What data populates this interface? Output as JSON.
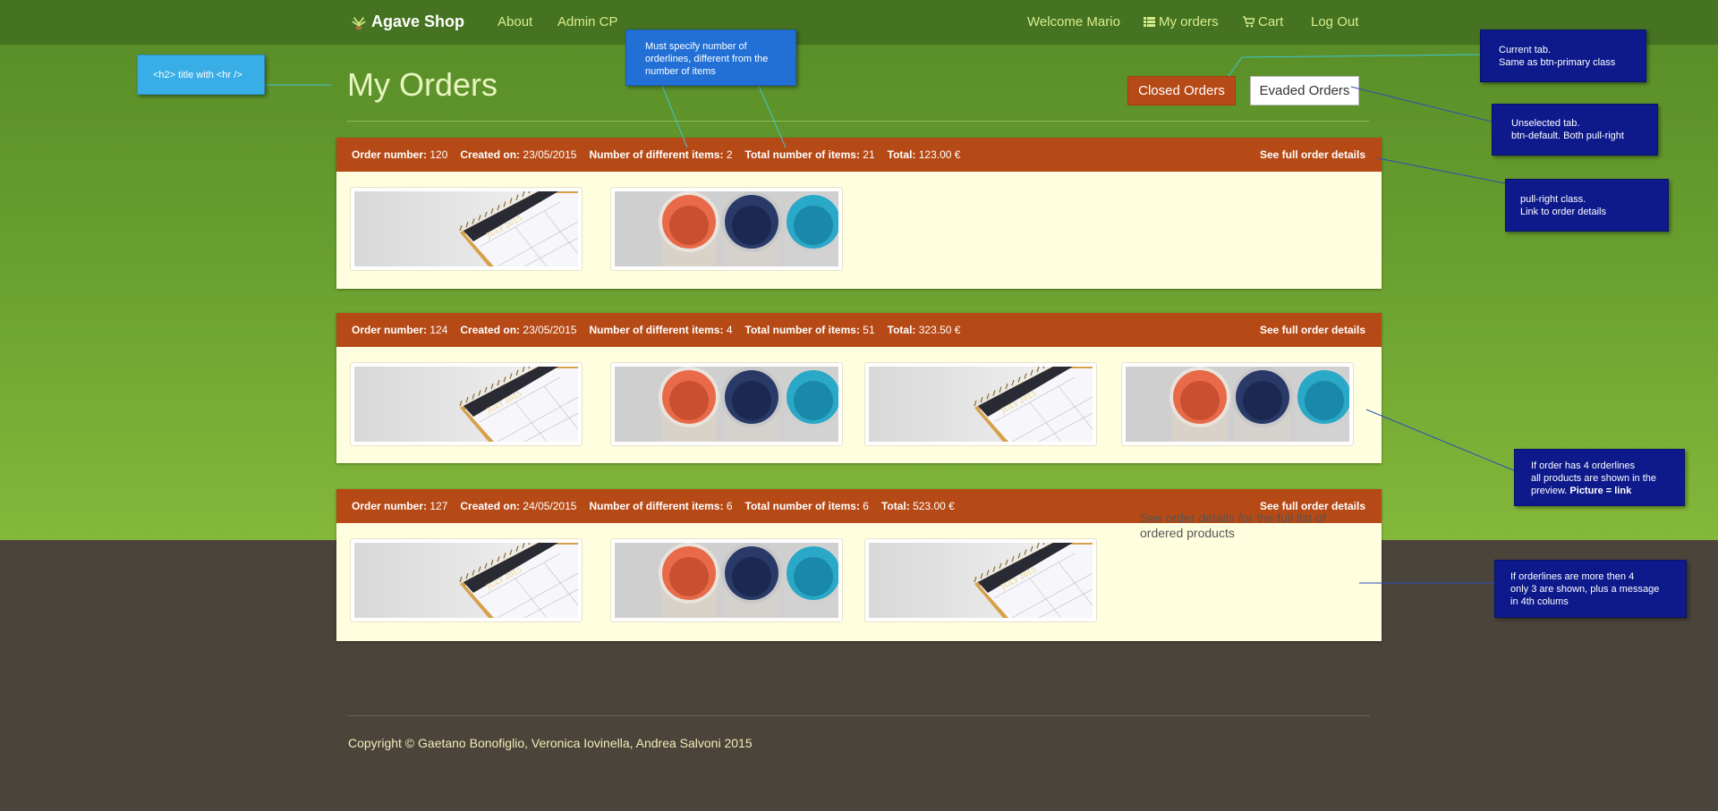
{
  "nav": {
    "brand": "Agave Shop",
    "about": "About",
    "admin": "Admin CP",
    "welcome": "Welcome Mario",
    "my_orders": "My orders",
    "cart": "Cart",
    "logout": "Log Out"
  },
  "page": {
    "title": "My Orders"
  },
  "tabs": {
    "closed": "Closed Orders",
    "evaded": "Evaded Orders"
  },
  "labels": {
    "order_number": "Order number:",
    "created_on": "Created on:",
    "different_items": "Number of different items:",
    "total_items": "Total number of items:",
    "total": "Total:",
    "details_link": "See full order details"
  },
  "orders": [
    {
      "number": "120",
      "created": "23/05/2015",
      "different": "2",
      "total_items": "21",
      "total": "123.00 €",
      "thumbs": [
        "calendar",
        "mugs"
      ]
    },
    {
      "number": "124",
      "created": "23/05/2015",
      "different": "4",
      "total_items": "51",
      "total": "323.50 €",
      "thumbs": [
        "calendar",
        "mugs",
        "calendar",
        "mugs"
      ]
    },
    {
      "number": "127",
      "created": "24/05/2015",
      "different": "6",
      "total_items": "6",
      "total": "523.00 €",
      "thumbs": [
        "calendar",
        "mugs",
        "calendar"
      ],
      "more_message": "See order details for the full list of ordered products"
    }
  ],
  "thumb_text": "JULY 2015",
  "footer": {
    "copyright": "Copyright © Gaetano Bonofiglio, Veronica Iovinella, Andrea Salvoni 2015"
  },
  "annotations": {
    "title_note": "<h2> title with <hr />",
    "orderlines_note": "Must specify number of orderlines, different from the number of items",
    "current_tab_note": "Current tab.\nSame as btn-primary class",
    "unselected_tab_note": "Unselected tab.\nbtn-default. Both pull-right",
    "pull_right_note": "pull-right class.\nLink to order details",
    "four_lines_note": "If order has 4 orderlines\nall products are shown in the preview. ",
    "four_lines_bold": "Picture = link",
    "more_lines_note": "If orderlines are more then 4\nonly 3 are shown, plus a message\nin 4th colums"
  },
  "colors": {
    "nav": "#457322",
    "accent": "#b64a16",
    "panel": "#fffedf",
    "footer": "#4b443b"
  }
}
